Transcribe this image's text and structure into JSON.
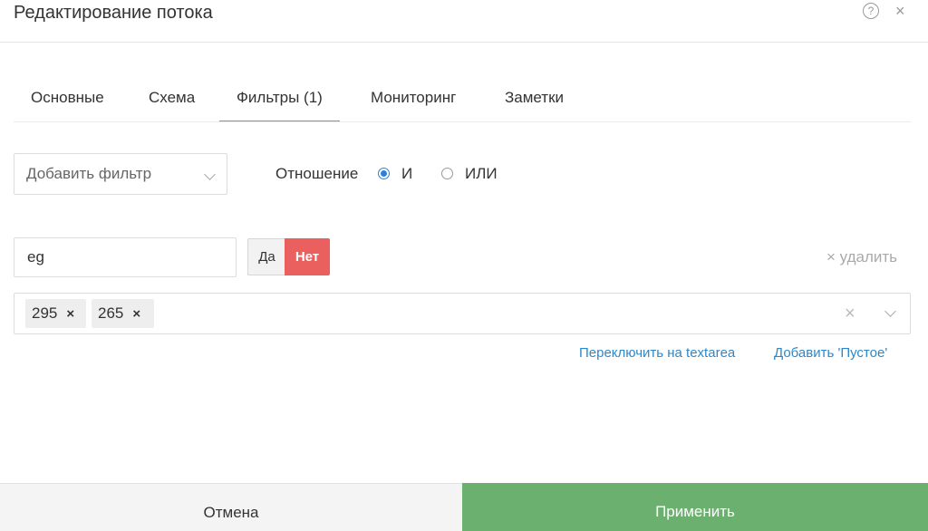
{
  "dialog": {
    "title": "Редактирование потока",
    "help_icon": "?",
    "close_icon": "×"
  },
  "tabs": [
    {
      "label": "Основные",
      "active": false
    },
    {
      "label": "Схема",
      "active": false
    },
    {
      "label": "Фильтры (1)",
      "active": true
    },
    {
      "label": "Мониторинг",
      "active": false
    },
    {
      "label": "Заметки",
      "active": false
    }
  ],
  "filter_controls": {
    "add_filter_placeholder": "Добавить фильтр",
    "relation_label": "Отношение",
    "relation_options": [
      {
        "label": "И",
        "checked": true
      },
      {
        "label": "ИЛИ",
        "checked": false
      }
    ]
  },
  "filter": {
    "field_value": "eg",
    "yes_label": "Да",
    "no_label": "Нет",
    "delete_label": "× удалить",
    "tags": [
      "295",
      "265"
    ],
    "tag_remove_icon": "×",
    "clear_icon": "×",
    "switch_textarea_link": "Переключить на textarea",
    "add_empty_link": "Добавить 'Пустое'"
  },
  "footer": {
    "cancel_label": "Отмена",
    "apply_label": "Применить"
  },
  "colors": {
    "accent_green": "#6cb06f",
    "danger_red": "#e9605f",
    "link_blue": "#2f87c7",
    "radio_blue": "#2f7fd9"
  }
}
